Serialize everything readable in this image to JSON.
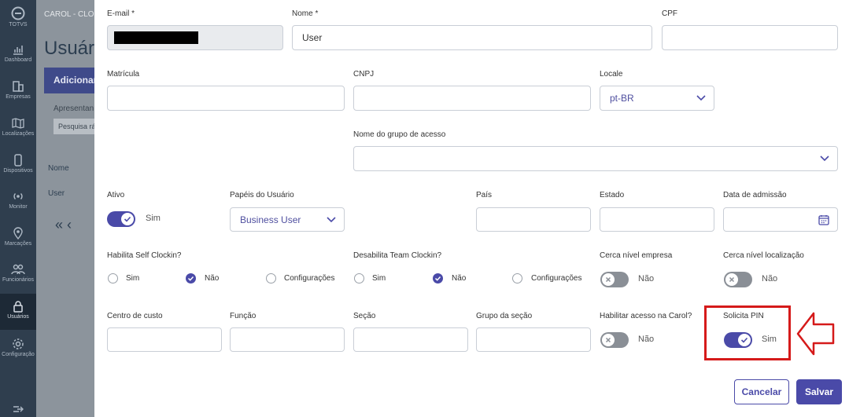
{
  "sidebar": {
    "brand": "TOTVS",
    "items": [
      {
        "label": "Dashboard",
        "icon": "bar-chart-icon"
      },
      {
        "label": "Empresas",
        "icon": "building-icon"
      },
      {
        "label": "Localizações",
        "icon": "map-icon"
      },
      {
        "label": "Dispositivos",
        "icon": "phone-icon"
      },
      {
        "label": "Monitor",
        "icon": "broadcast-icon"
      },
      {
        "label": "Marcações",
        "icon": "location-pin-icon"
      },
      {
        "label": "Funcionários",
        "icon": "people-icon"
      },
      {
        "label": "Usuários",
        "icon": "lock-icon",
        "active": true
      },
      {
        "label": "Configuração",
        "icon": "gear-icon"
      }
    ],
    "collapse_icon": "expand-arrow-icon"
  },
  "background": {
    "breadcrumb": "CAROL - CLO",
    "title": "Usuár",
    "add_button": "Adicionar",
    "show_label": "Apresentan",
    "quick_search": "Pesquisa rápi",
    "column_header": "Nome",
    "cell": "User",
    "pager": "« ‹"
  },
  "form": {
    "email": {
      "label": "E-mail *",
      "value": "[redacted]",
      "disabled": true
    },
    "name": {
      "label": "Nome *",
      "value": "User"
    },
    "cpf": {
      "label": "CPF",
      "value": ""
    },
    "matricula": {
      "label": "Matrícula",
      "value": ""
    },
    "cnpj": {
      "label": "CNPJ",
      "value": ""
    },
    "locale": {
      "label": "Locale",
      "value": "pt-BR"
    },
    "access_group": {
      "label": "Nome do grupo de acesso",
      "value": ""
    },
    "ativo": {
      "label": "Ativo",
      "state": "on",
      "text": "Sim"
    },
    "roles": {
      "label": "Papéis do Usuário",
      "value": "Business User"
    },
    "pais": {
      "label": "País",
      "value": ""
    },
    "estado": {
      "label": "Estado",
      "value": ""
    },
    "admission_date": {
      "label": "Data de admissão",
      "value": "",
      "icon": "calendar-icon"
    },
    "self_clockin": {
      "label": "Habilita Self Clockin?",
      "options": [
        "Sim",
        "Não",
        "Configurações"
      ],
      "selected": "Não"
    },
    "team_clockin": {
      "label": "Desabilita Team Clockin?",
      "options": [
        "Sim",
        "Não",
        "Configurações"
      ],
      "selected": "Não"
    },
    "fence_company": {
      "label": "Cerca nível empresa",
      "state": "off",
      "text": "Não"
    },
    "fence_location": {
      "label": "Cerca nível localização",
      "state": "off",
      "text": "Não"
    },
    "cost_center": {
      "label": "Centro de custo",
      "value": ""
    },
    "funcao": {
      "label": "Função",
      "value": ""
    },
    "secao": {
      "label": "Seção",
      "value": ""
    },
    "section_group": {
      "label": "Grupo da seção",
      "value": ""
    },
    "carol_access": {
      "label": "Habilitar acesso na Carol?",
      "state": "off",
      "text": "Não"
    },
    "pin": {
      "label": "Solicita PIN",
      "state": "on",
      "text": "Sim"
    }
  },
  "actions": {
    "cancel": "Cancelar",
    "save": "Salvar"
  },
  "colors": {
    "accent": "#4a4aa8",
    "annotation": "#d51a1a",
    "sidebar": "#2f3e4e"
  }
}
